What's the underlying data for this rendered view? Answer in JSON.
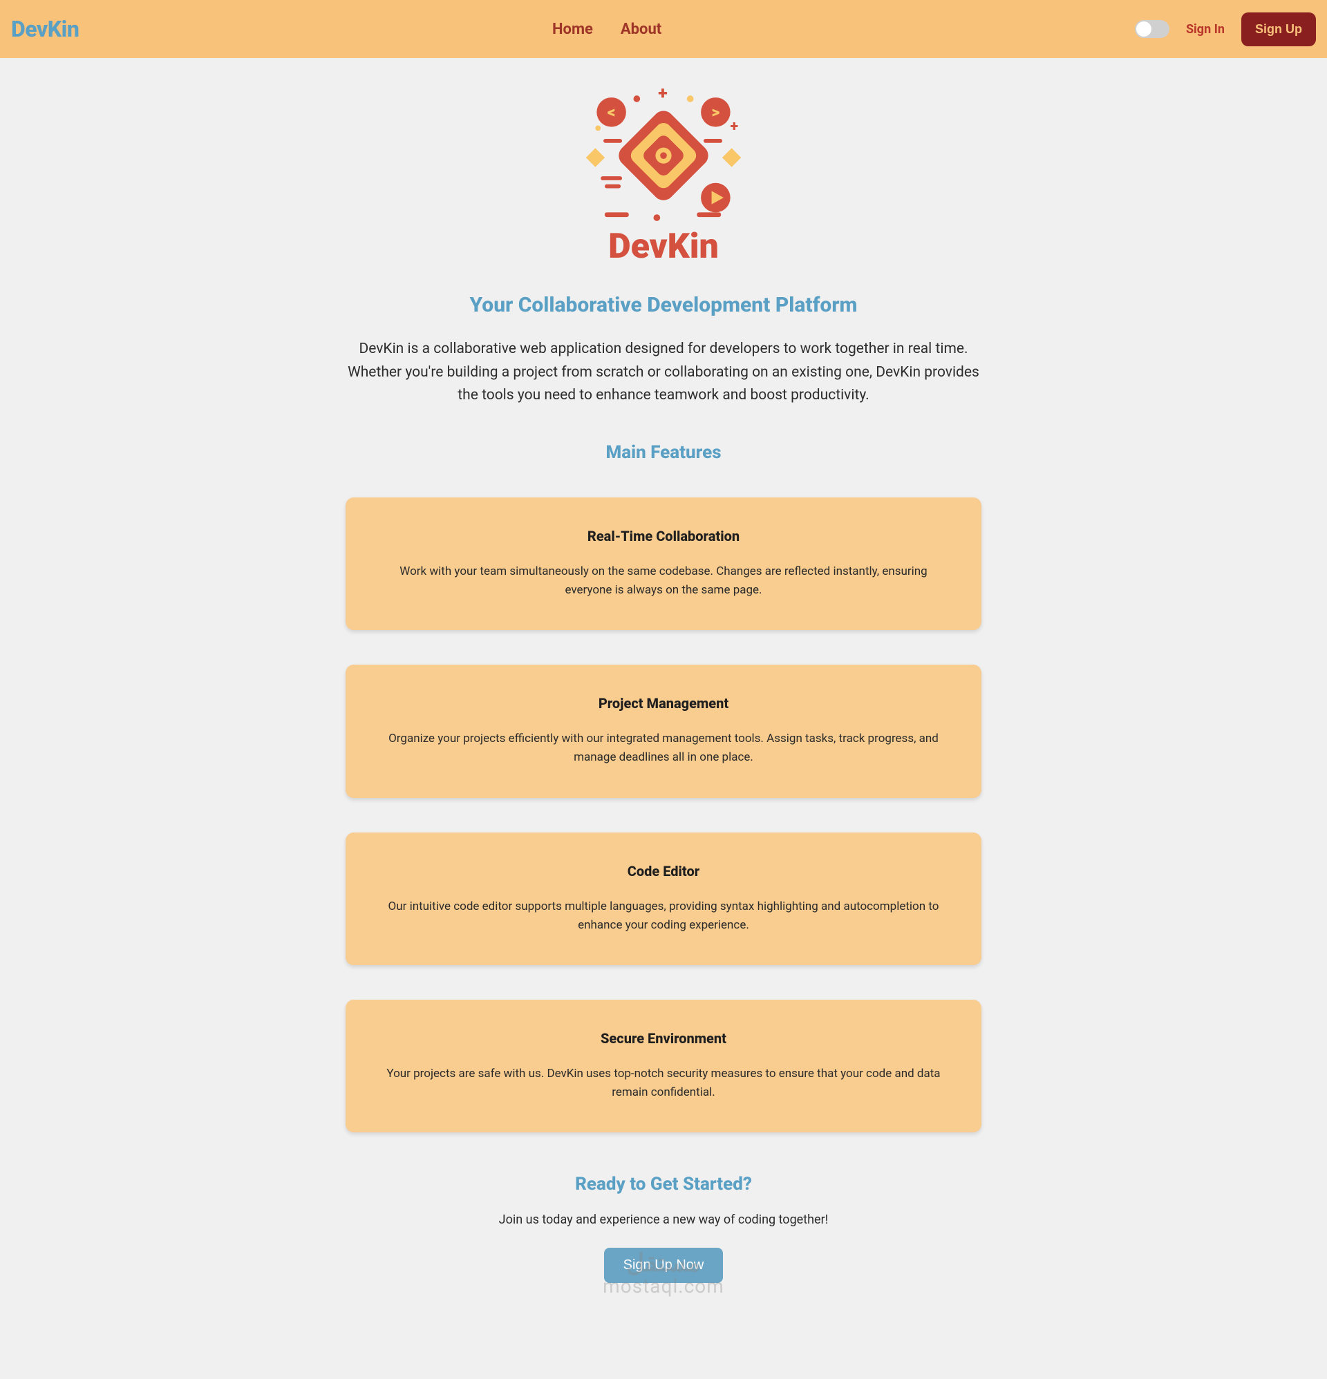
{
  "nav": {
    "brand": "DevKin",
    "links": {
      "home": "Home",
      "about": "About"
    },
    "signin": "Sign In",
    "signup": "Sign Up"
  },
  "hero": {
    "logo_text": "DevKin",
    "subtitle": "Your Collaborative Development Platform",
    "intro": "DevKin is a collaborative web application designed for developers to work together in real time. Whether you're building a project from scratch or collaborating on an existing one, DevKin provides the tools you need to enhance teamwork and boost productivity."
  },
  "features": {
    "title": "Main Features",
    "items": [
      {
        "title": "Real-Time Collaboration",
        "desc": "Work with your team simultaneously on the same codebase. Changes are reflected instantly, ensuring everyone is always on the same page."
      },
      {
        "title": "Project Management",
        "desc": "Organize your projects efficiently with our integrated management tools. Assign tasks, track progress, and manage deadlines all in one place."
      },
      {
        "title": "Code Editor",
        "desc": "Our intuitive code editor supports multiple languages, providing syntax highlighting and autocompletion to enhance your coding experience."
      },
      {
        "title": "Secure Environment",
        "desc": "Your projects are safe with us. DevKin uses top-notch security measures to ensure that your code and data remain confidential."
      }
    ]
  },
  "cta": {
    "title": "Ready to Get Started?",
    "text": "Join us today and experience a new way of coding together!",
    "button": "Sign Up Now"
  },
  "watermark": {
    "arabic": "مستقل",
    "latin": "mostaql.com"
  },
  "colors": {
    "accent_blue": "#5a9fc4",
    "nav_bg": "#f9c27a",
    "card_bg": "#f9cc8f",
    "brand_red": "#9e3528",
    "btn_dark_red": "#8a1f1f"
  }
}
